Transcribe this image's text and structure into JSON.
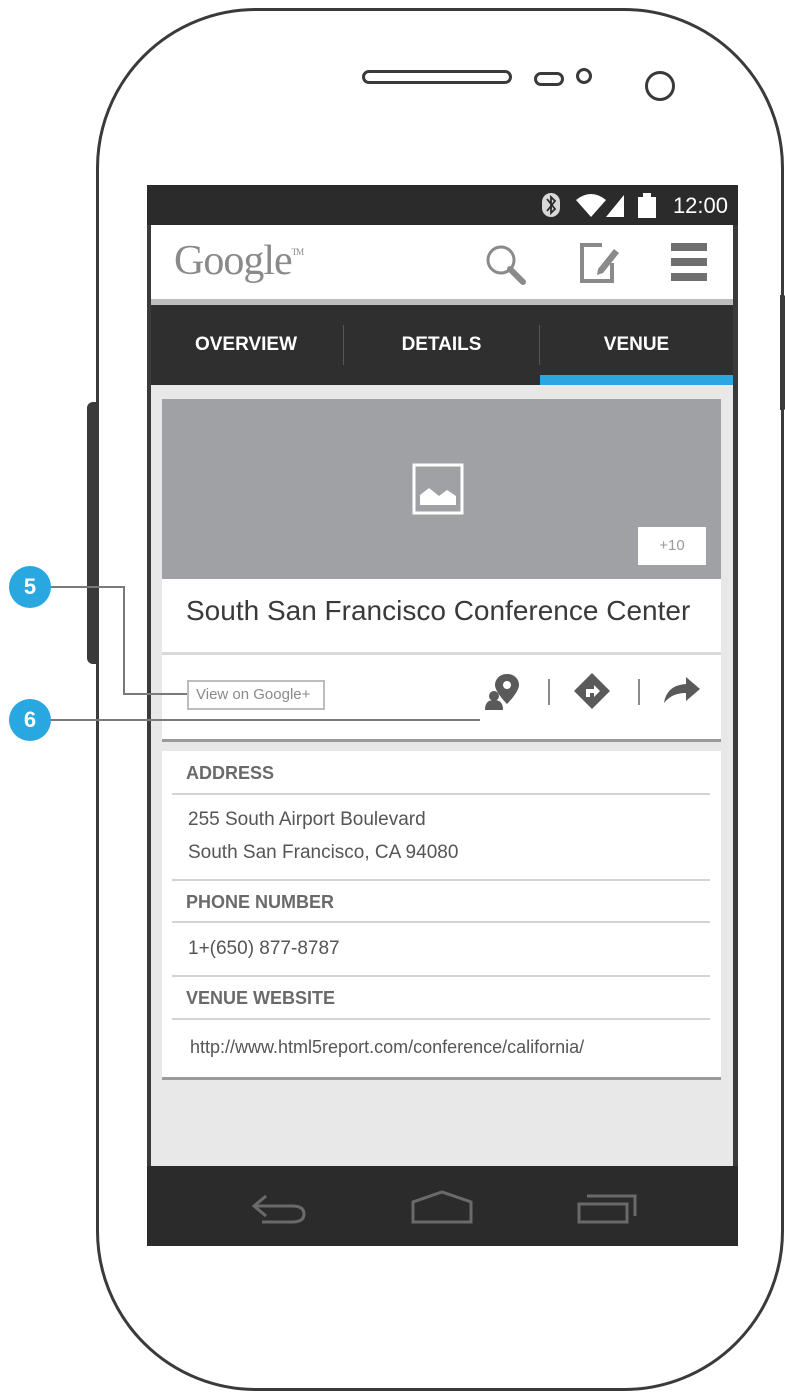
{
  "status_bar": {
    "time": "12:00"
  },
  "app_bar": {
    "logo": "Google",
    "logo_tm": "TM",
    "icons": [
      "search-icon",
      "compose-icon",
      "menu-icon"
    ]
  },
  "tabs": [
    {
      "label": "OVERVIEW",
      "active": false
    },
    {
      "label": "DETAILS",
      "active": false
    },
    {
      "label": "VENUE",
      "active": true
    }
  ],
  "venue": {
    "photo_count": "+10",
    "name": "South San Francisco Conference Center",
    "google_plus_link": "View on Google+"
  },
  "info": {
    "address_label": "ADDRESS",
    "address_line1": "255 South Airport Boulevard",
    "address_line2": "South San Francisco, CA 94080",
    "phone_label": "PHONE NUMBER",
    "phone": "1+(650) 877-8787",
    "website_label": "VENUE WEBSITE",
    "website": "http://www.html5report.com/conference/california/"
  },
  "callouts": [
    "5",
    "6"
  ],
  "colors": {
    "accent": "#29a7e1",
    "dark_bar": "#2b2b2b",
    "tab_bar": "#2f2f2f",
    "photo": "#a0a1a4"
  }
}
